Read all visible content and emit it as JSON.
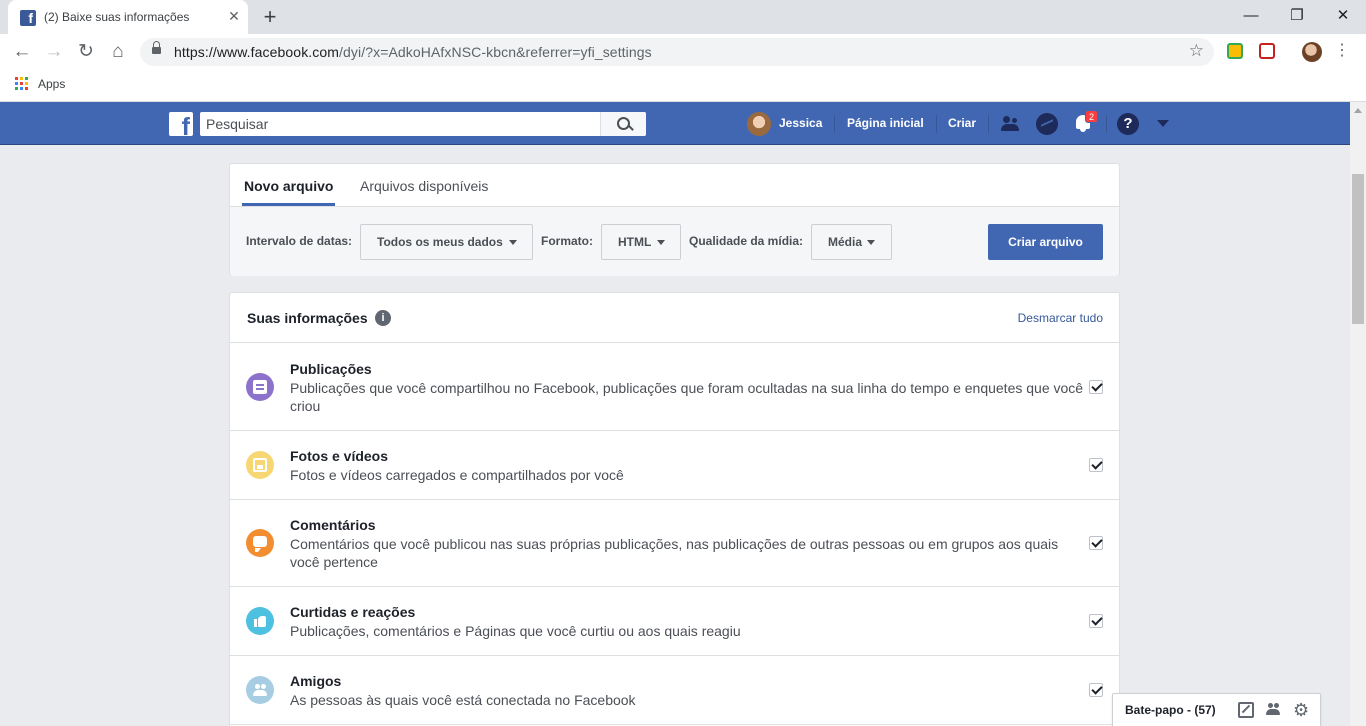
{
  "browser": {
    "tab_title": "(2) Baixe suas informações",
    "tab_close": "✕",
    "new_tab": "+",
    "url_host": "https://www.facebook.com",
    "url_path": "/dyi/?x=AdkoHAfxNSC-kbcn&referrer=yfi_settings",
    "bookmarks_apps": "Apps",
    "window_controls": [
      "—",
      "❐",
      "✕"
    ],
    "apps_grid_colors": [
      "#ea4335",
      "#fbbc05",
      "#34a853",
      "#4285f4",
      "#ea4335",
      "#fbbc05",
      "#34a853",
      "#4285f4",
      "#ea4335"
    ]
  },
  "facebook": {
    "logo_letter": "f",
    "search_placeholder": "Pesquisar",
    "user_name": "Jessica",
    "nav_home": "Página inicial",
    "nav_create": "Criar",
    "notifications_count": "2",
    "help_glyph": "?"
  },
  "download": {
    "tab_new": "Novo arquivo",
    "tab_available": "Arquivos disponíveis",
    "date_range_label": "Intervalo de datas:",
    "date_range_value": "Todos os meus dados",
    "format_label": "Formato:",
    "format_value": "HTML",
    "quality_label": "Qualidade da mídia:",
    "quality_value": "Média",
    "create_button": "Criar arquivo"
  },
  "info": {
    "title": "Suas informações",
    "info_glyph": "i",
    "deselect_all": "Desmarcar tudo",
    "categories": [
      {
        "title": "Publicações",
        "description": "Publicações que você compartilhou no Facebook, publicações que foram ocultadas na sua linha do tempo e enquetes que você criou",
        "color": "#8c72cb",
        "icon": "posts-icon",
        "checked": true
      },
      {
        "title": "Fotos e vídeos",
        "description": "Fotos e vídeos carregados e compartilhados por você",
        "color": "#f7d774",
        "icon": "photos-icon",
        "checked": true
      },
      {
        "title": "Comentários",
        "description": "Comentários que você publicou nas suas próprias publicações, nas publicações de outras pessoas ou em grupos aos quais você pertence",
        "color": "#f28d30",
        "icon": "comment-icon",
        "checked": true
      },
      {
        "title": "Curtidas e reações",
        "description": "Publicações, comentários e Páginas que você curtiu ou aos quais reagiu",
        "color": "#4ec0e0",
        "icon": "like-icon",
        "checked": true
      },
      {
        "title": "Amigos",
        "description": "As pessoas às quais você está conectada no Facebook",
        "color": "#a7cde3",
        "icon": "friends-icon",
        "checked": true
      }
    ]
  },
  "chat": {
    "label": "Bate-papo - (57)",
    "gear_glyph": "⚙"
  }
}
